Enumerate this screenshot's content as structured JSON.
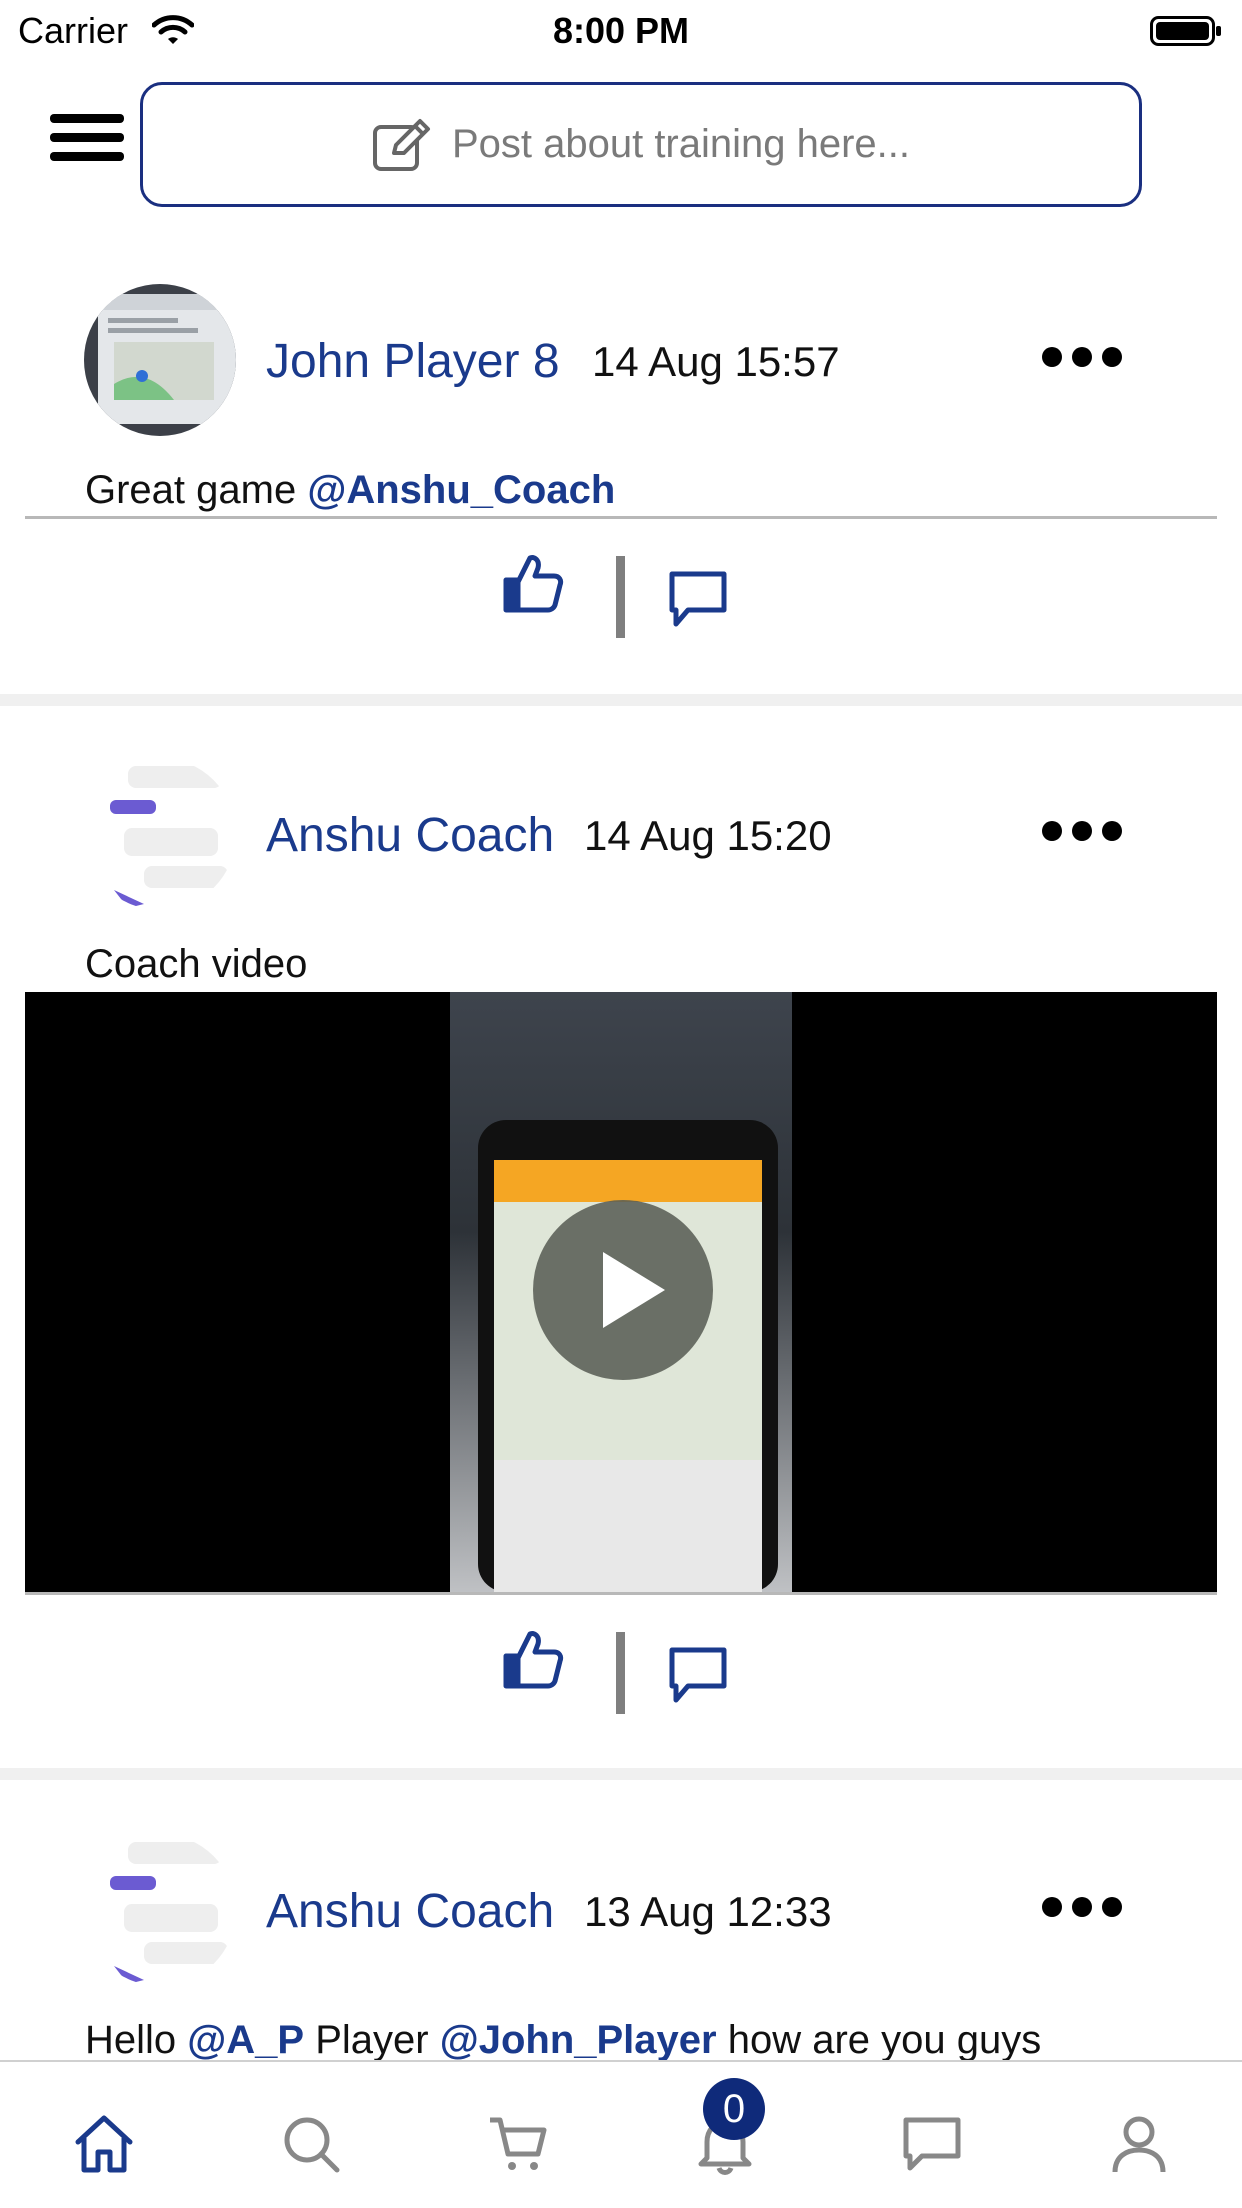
{
  "status_bar": {
    "carrier": "Carrier",
    "time": "8:00 PM"
  },
  "header": {
    "post_placeholder": "Post about training here..."
  },
  "posts": [
    {
      "author": "John Player 8",
      "timestamp": "14 Aug 15:57",
      "text_parts": [
        "Great game ",
        "@Anshu_Coach"
      ]
    },
    {
      "author": "Anshu Coach",
      "timestamp": "14 Aug 15:20",
      "text_parts": [
        "Coach video"
      ],
      "has_video": true
    },
    {
      "author": "Anshu Coach",
      "timestamp": "13 Aug 12:33",
      "text_parts": [
        "Hello ",
        "@A_P",
        " Player ",
        "@John_Player",
        " how are you guys"
      ]
    }
  ],
  "tabbar": {
    "tabs": [
      "home-icon",
      "search-icon",
      "cart-icon",
      "bell-icon",
      "chat-icon",
      "profile-icon"
    ],
    "notification_count": "0"
  },
  "colors": {
    "brand": "#1a3a8c",
    "badge": "#0f2a7a",
    "divider": "#7f7f7f"
  }
}
